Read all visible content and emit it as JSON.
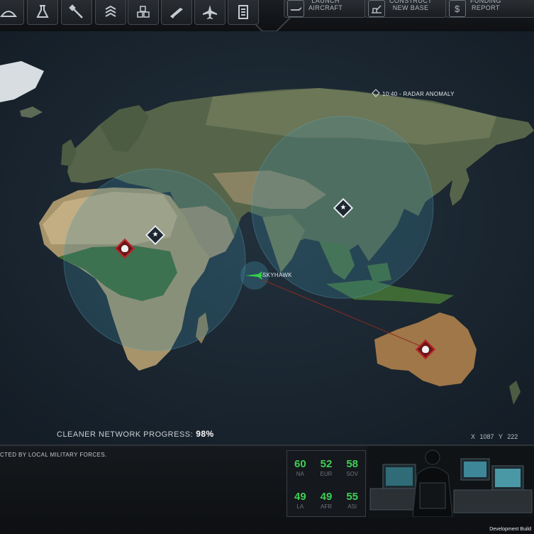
{
  "toolbar": {
    "tool_buttons": [
      {
        "icon": "hangar-icon"
      },
      {
        "icon": "research-icon"
      },
      {
        "icon": "engineering-icon"
      },
      {
        "icon": "soldier-rank-icon"
      },
      {
        "icon": "stores-icon"
      },
      {
        "icon": "rifle-icon"
      },
      {
        "icon": "fighter-jet-icon"
      },
      {
        "icon": "archives-icon"
      }
    ],
    "actions": [
      {
        "label": "LAUNCH\nAIRCRAFT",
        "icon": "aircraft-icon"
      },
      {
        "label": "CONSTRUCT\nNEW BASE",
        "icon": "construct-icon"
      },
      {
        "label": "FUNDING\nREPORT",
        "icon": "funding-icon"
      }
    ]
  },
  "map": {
    "radar_event": "10:40 - RADAR ANOMALY",
    "aircraft_name": "SKYHAWK",
    "progress_label": "CLEANER NETWORK PROGRESS:",
    "progress_value": "98%",
    "coords_x": "X 1087",
    "coords_y": "Y 222"
  },
  "colors": {
    "ocean": "#1a2733",
    "alien_red": "#c0282c",
    "aircraft_green": "#35d14b",
    "panic_green": "#3fcf56",
    "radar_circle": "#3e8aa3"
  },
  "bottom": {
    "log_text": "CTED BY LOCAL MILITARY FORCES.",
    "panic_regions": [
      {
        "value": "60",
        "name": "NA"
      },
      {
        "value": "52",
        "name": "EUR"
      },
      {
        "value": "58",
        "name": "SOV"
      },
      {
        "value": "49",
        "name": "LA"
      },
      {
        "value": "49",
        "name": "AFR"
      },
      {
        "value": "55",
        "name": "ASI"
      }
    ],
    "dev_build": "Development Build"
  }
}
